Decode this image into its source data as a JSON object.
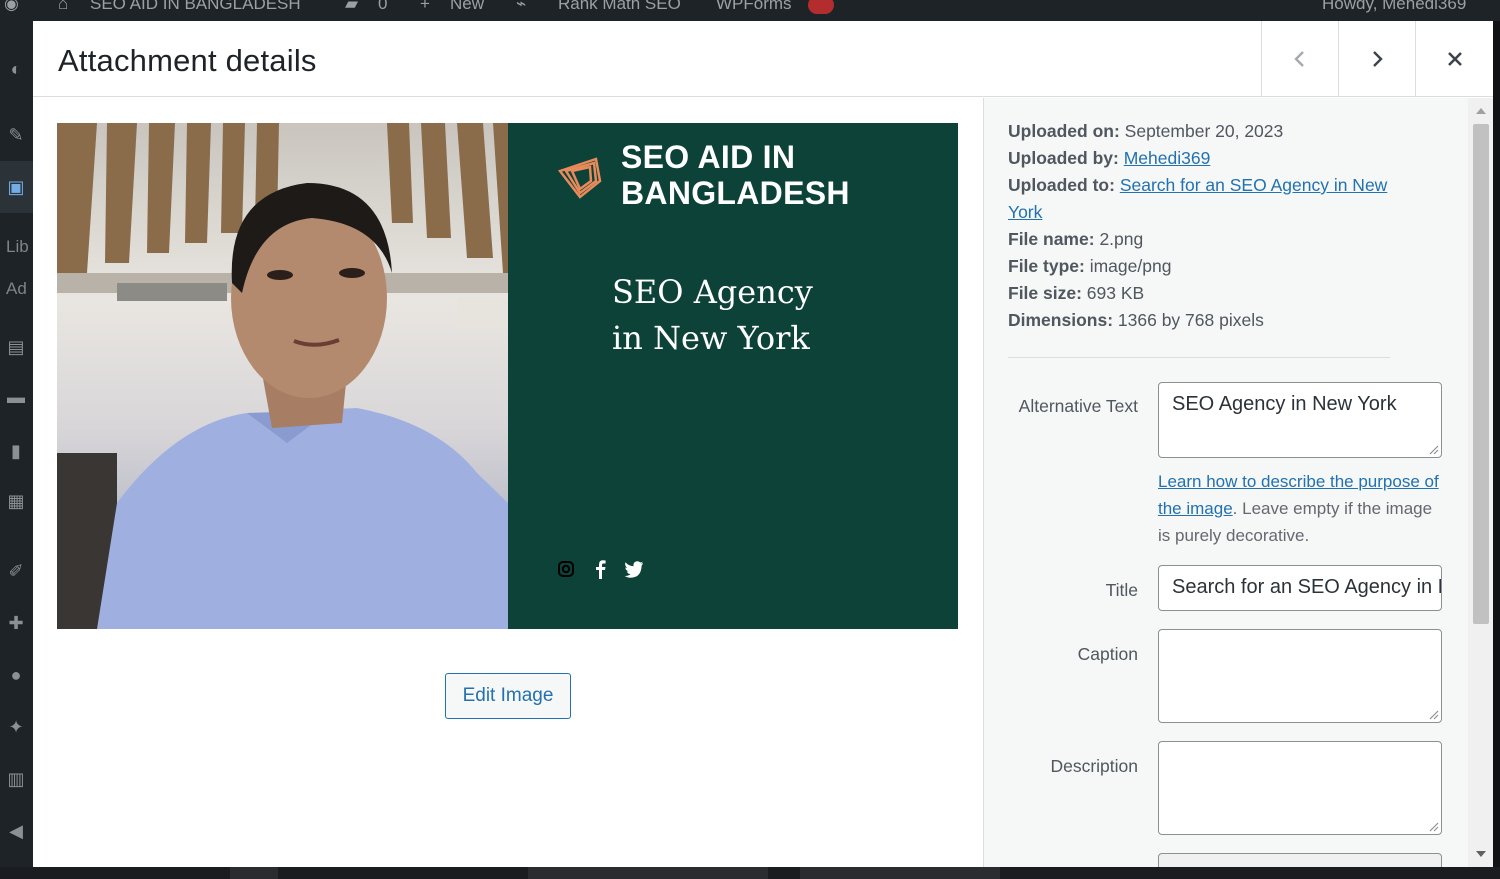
{
  "admin_bar": {
    "site_name": "SEO AID IN BANGLADESH",
    "comments_count": "0",
    "new_label": "New",
    "rank_math_label": "Rank Math SEO",
    "wpforms_label": "WPForms",
    "howdy": "Howdy, Mehedi369"
  },
  "side_menu": {
    "library_label": "Lib",
    "add_label": "Ad"
  },
  "modal": {
    "title": "Attachment details",
    "prev_icon": "chevron-left-icon",
    "next_icon": "chevron-right-icon",
    "close_icon": "close-icon"
  },
  "preview": {
    "brand_line1": "SEO AID IN",
    "brand_line2": "BANGLADESH",
    "headline_line1": "SEO Agency",
    "headline_line2": "in New York",
    "social_icons": [
      "instagram-icon",
      "facebook-icon",
      "twitter-icon"
    ],
    "green_color": "#0d4238"
  },
  "edit_image_label": "Edit Image",
  "details": {
    "uploaded_on_label": "Uploaded on:",
    "uploaded_on_value": "September 20, 2023",
    "uploaded_by_label": "Uploaded by:",
    "uploaded_by_value": "Mehedi369",
    "uploaded_to_label": "Uploaded to:",
    "uploaded_to_value": "Search for an SEO Agency in New York",
    "file_name_label": "File name:",
    "file_name_value": "2.png",
    "file_type_label": "File type:",
    "file_type_value": "image/png",
    "file_size_label": "File size:",
    "file_size_value": "693 KB",
    "dimensions_label": "Dimensions:",
    "dimensions_value": "1366 by 768 pixels"
  },
  "fields": {
    "alt_label": "Alternative Text",
    "alt_value": "SEO Agency in New York",
    "help_link": "Learn how to describe the purpose of the image",
    "help_text": ". Leave empty if the image is purely decorative.",
    "title_label": "Title",
    "title_value": "Search for an SEO Agency in New York",
    "caption_label": "Caption",
    "caption_value": "",
    "description_label": "Description",
    "description_value": ""
  },
  "colors": {
    "link": "#2271b1",
    "admin_bg": "#1d2327"
  }
}
